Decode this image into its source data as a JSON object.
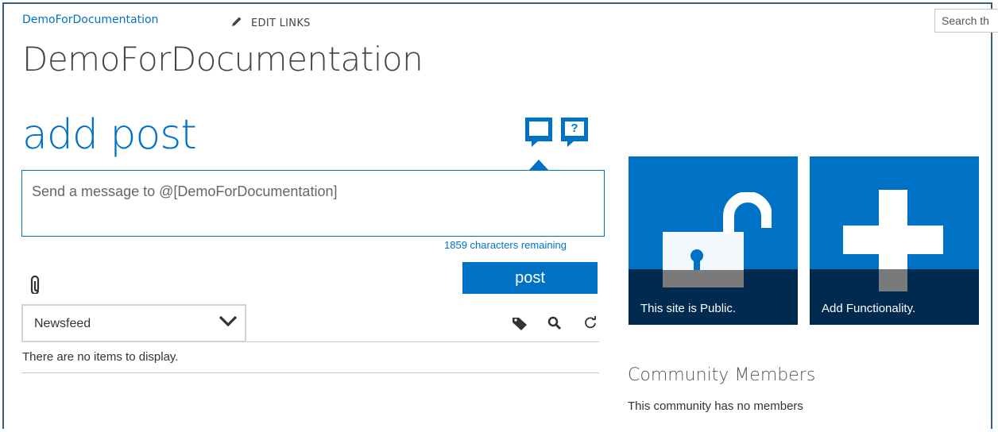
{
  "header": {
    "breadcrumb_site": "DemoForDocumentation",
    "edit_links": "EDIT LINKS",
    "search_placeholder": "Search th",
    "site_title": "DemoForDocumentation"
  },
  "composer": {
    "heading": "add post",
    "placeholder": "Send a message to @[DemoForDocumentation]",
    "chars_remaining": "1859 characters remaining",
    "post_button": "post",
    "icons": [
      "attachment-icon",
      "discussion-icon",
      "question-icon"
    ]
  },
  "feed": {
    "selected_view": "Newsfeed",
    "empty_message": "There are no items to display.",
    "icons": [
      "tag-icon",
      "search-icon",
      "refresh-icon"
    ]
  },
  "tiles": [
    {
      "label": "This site is Public.",
      "icon": "open-lock-icon"
    },
    {
      "label": "Add Functionality.",
      "icon": "plus-icon"
    }
  ],
  "community": {
    "title": "Community Members",
    "empty_message": "This community has no members"
  },
  "colors": {
    "accent": "#0072c6",
    "tile_band": "#002a4f",
    "frame": "#2f5f8a"
  }
}
